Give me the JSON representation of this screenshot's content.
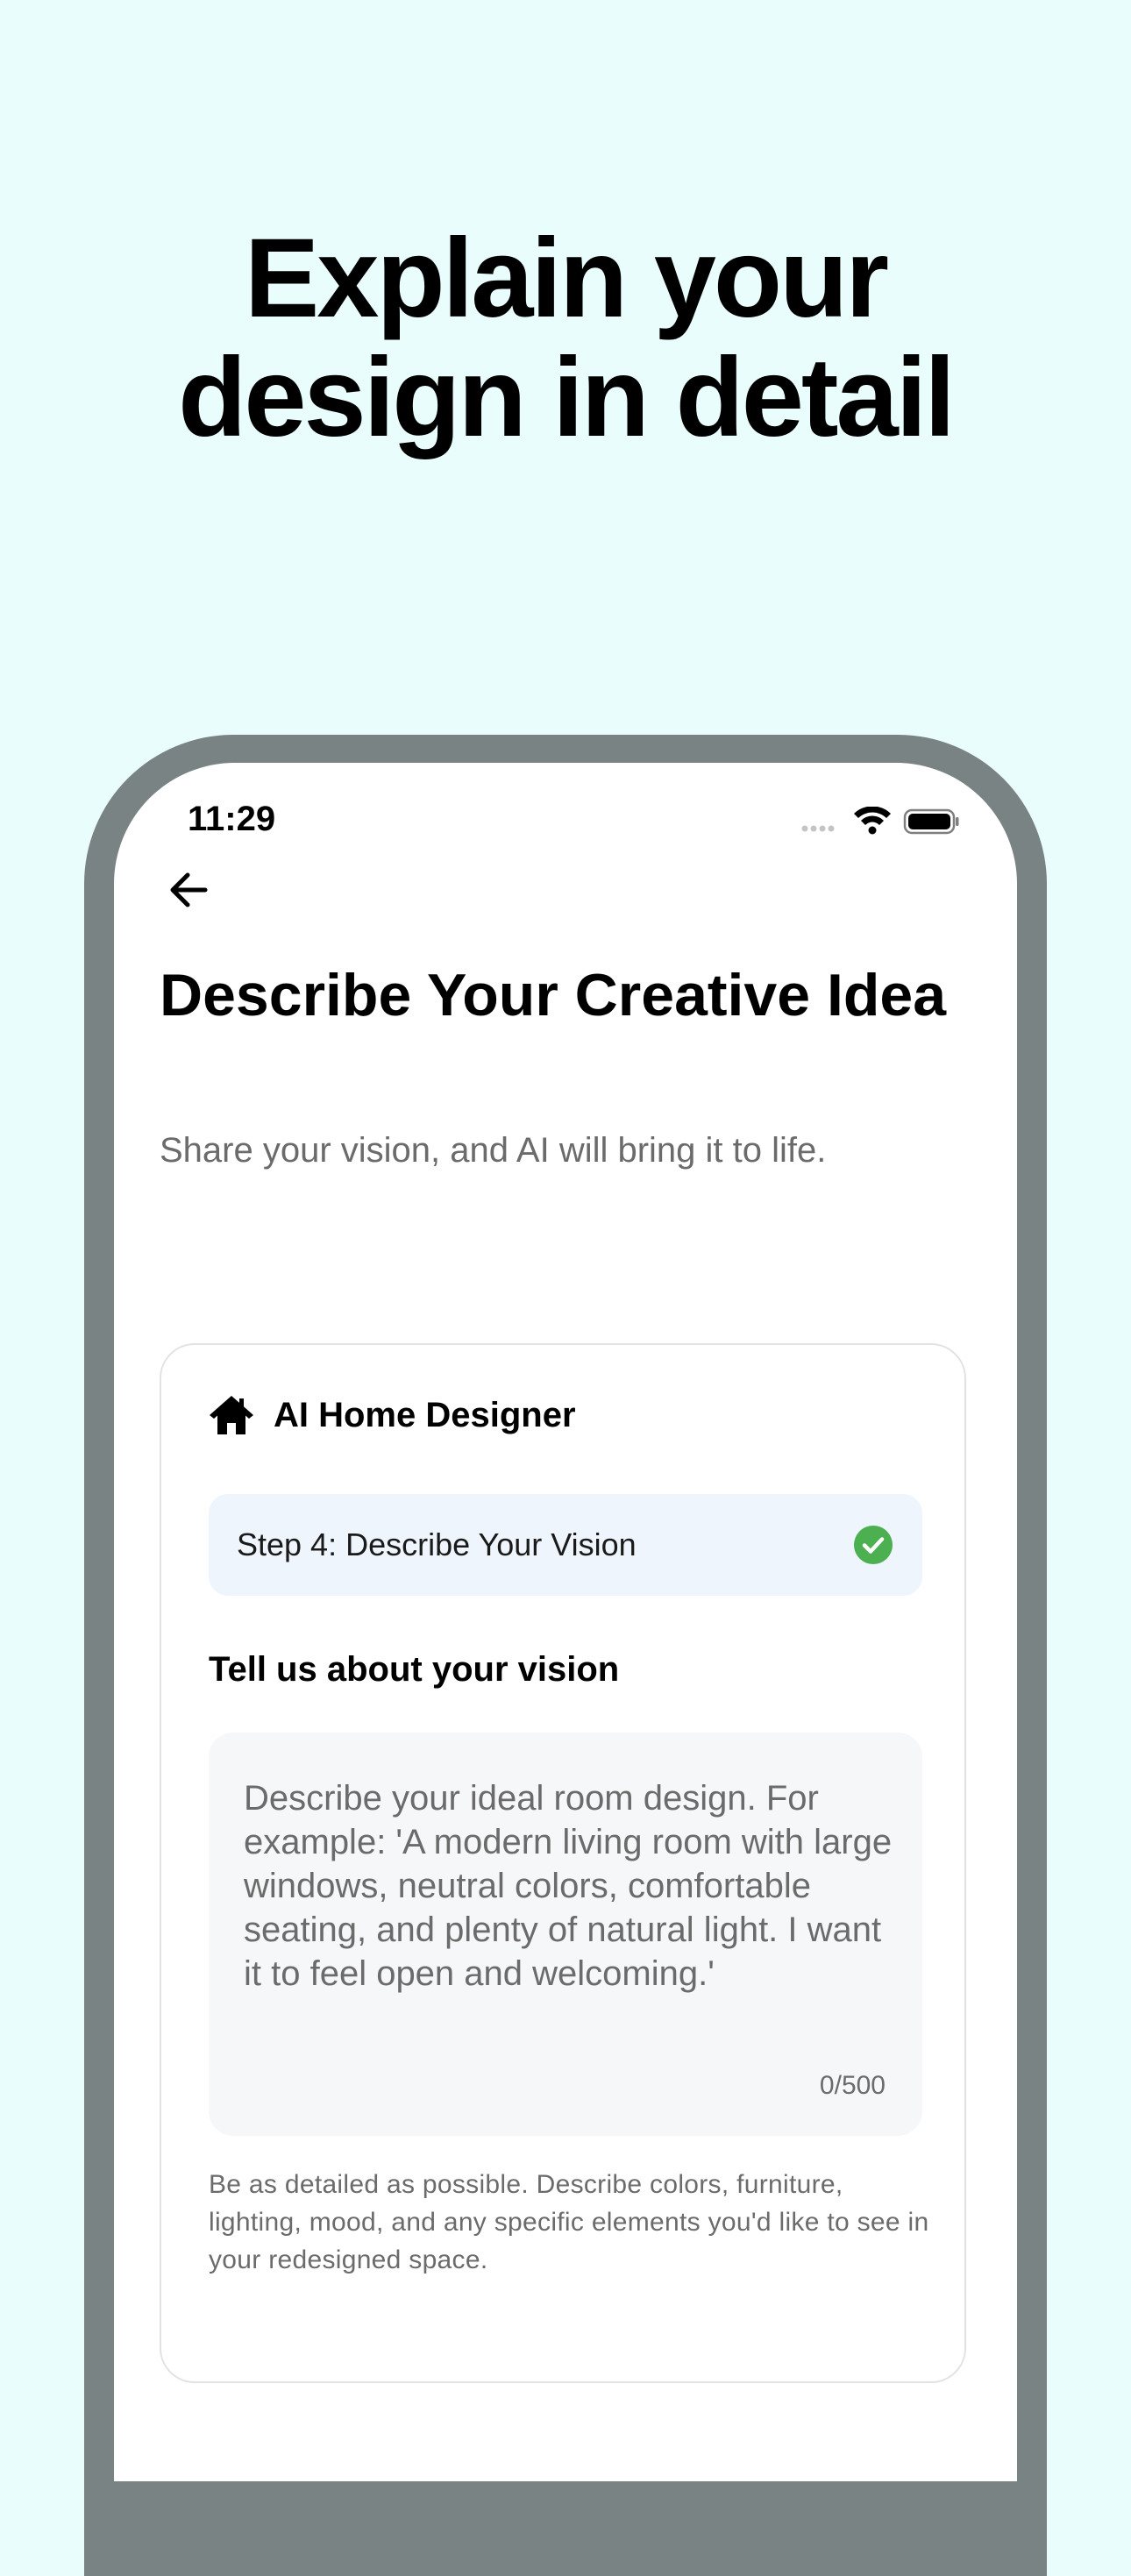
{
  "promo": {
    "headline_line1": "Explain your",
    "headline_line2": "design in detail"
  },
  "status_bar": {
    "time": "11:29",
    "icons": [
      "signal-icon",
      "wifi-icon",
      "battery-icon"
    ]
  },
  "nav": {
    "back_icon": "arrow-left-icon"
  },
  "page": {
    "title": "Describe Your Creative Idea",
    "subtitle": "Share your vision, and AI will bring it to life."
  },
  "card": {
    "icon": "home-icon",
    "title": "AI Home Designer",
    "step": {
      "label": "Step 4: Describe Your Vision",
      "status_icon": "check-circle-icon",
      "status_color": "#4caf50"
    },
    "section_heading": "Tell us about your vision",
    "input": {
      "value": "",
      "placeholder": "Describe your ideal room design. For example: 'A modern living room with large windows, neutral colors, comfortable seating, and plenty of natural light. I want it to feel open and welcoming.'",
      "counter": "0/500"
    },
    "help_text": "Be as detailed as possible. Describe colors, furniture, lighting, mood, and any specific elements you'd like to see in your redesigned space."
  },
  "colors": {
    "page_background": "#e9fdfd",
    "frame": "#7a8383",
    "step_background": "#eef5fd",
    "input_background": "#f6f7f8"
  }
}
